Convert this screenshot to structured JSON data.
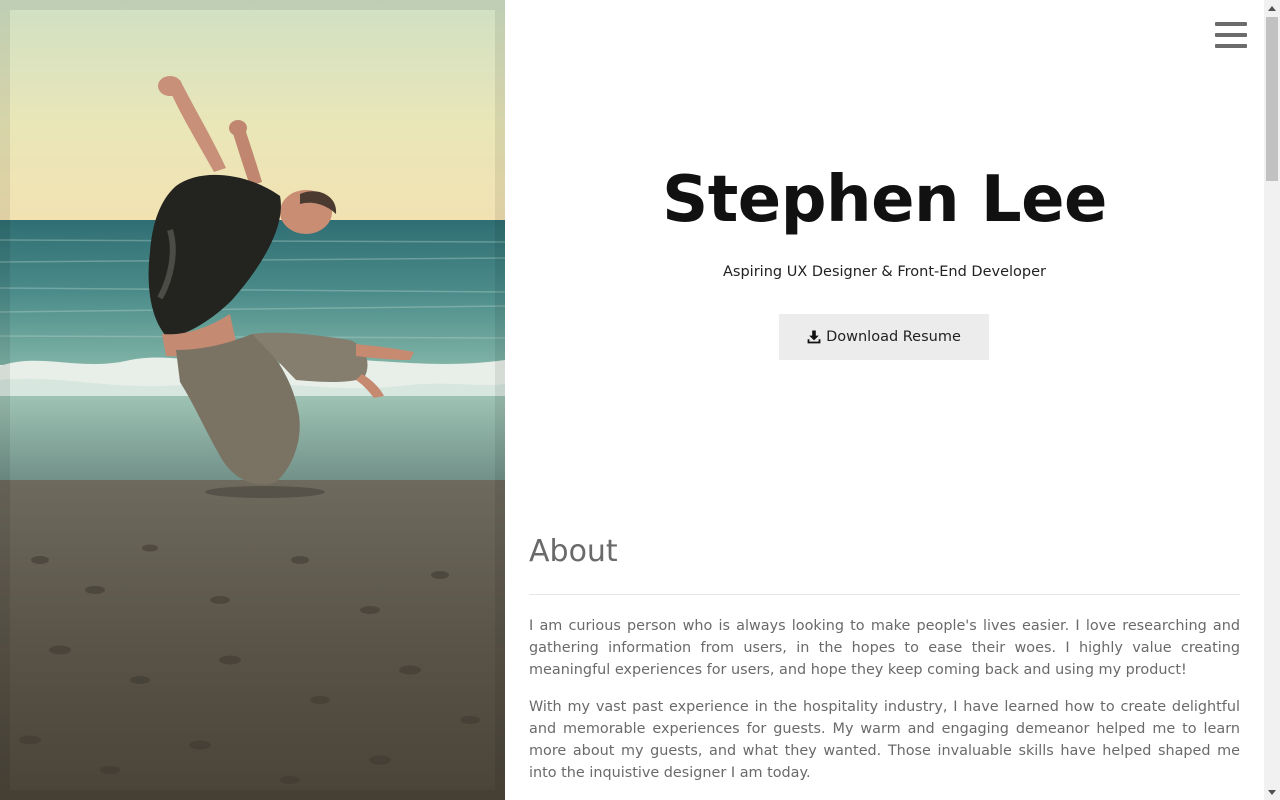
{
  "header": {
    "menu_icon": "hamburger-menu-icon"
  },
  "hero": {
    "photo_alt": "Man jumping on the beach",
    "name": "Stephen Lee",
    "tagline": "Aspiring UX Designer & Front-End Developer",
    "download_button": {
      "icon": "download-icon",
      "label": "Download Resume"
    }
  },
  "about": {
    "heading": "About",
    "paragraphs": [
      "I am curious person who is always looking to make people's lives easier. I love researching and gathering information from users, in the hopes to ease their woes. I highly value creating meaningful experiences for users, and hope they keep coming back and using my product!",
      "With my vast past experience in the hospitality industry, I have learned how to create delightful and memorable experiences for guests. My warm and engaging demeanor helped me to learn more about my guests, and what they wanted. Those invaluable skills have helped shaped me into the inquistive designer I am today."
    ]
  },
  "colors": {
    "name_text": "#111111",
    "body_text": "#6a6a6a",
    "button_bg": "#ececec",
    "menu_icon": "#6b6b6b"
  }
}
